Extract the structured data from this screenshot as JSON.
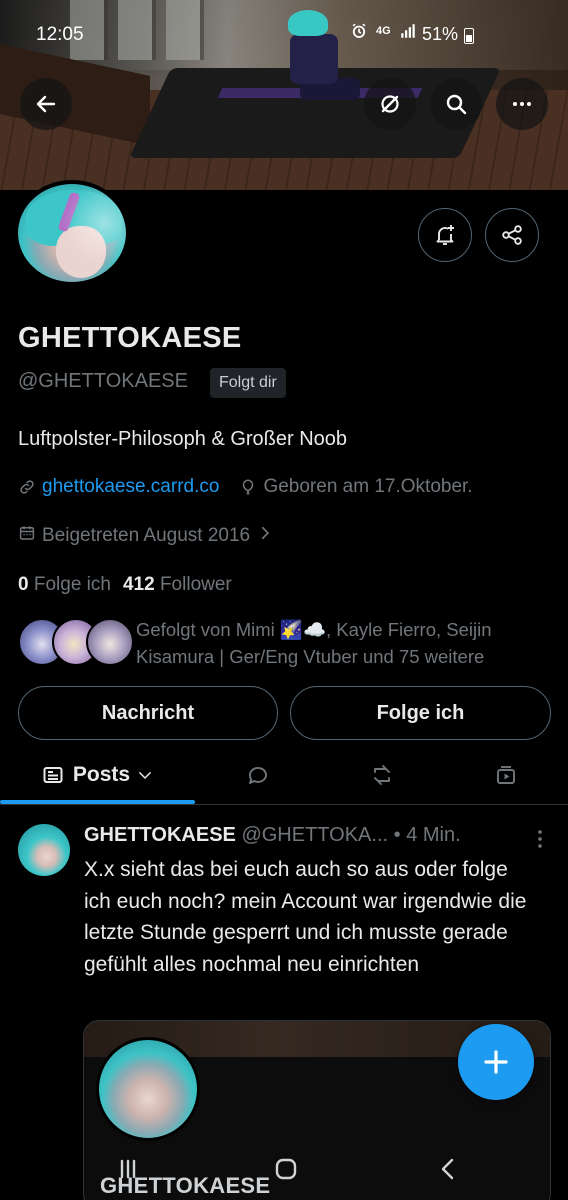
{
  "status_bar": {
    "time": "12:05",
    "network": "4G",
    "battery_percent": "51%"
  },
  "header": {
    "back_icon": "arrow-left-icon",
    "grok_icon": "slash-circle-icon",
    "search_icon": "search-icon",
    "more_icon": "more-horizontal-icon"
  },
  "profile": {
    "display_name": "GHETTOKAESE",
    "handle": "@GHETTOKAESE",
    "follows_you_badge": "Folgt dir",
    "bio": "Luftpolster-Philosoph & Großer Noob",
    "website": "ghettokaese.carrd.co",
    "birthday": "Geboren am 17.Oktober.",
    "joined": "Beigetreten August 2016",
    "following_count": "0",
    "following_label": "Folge ich",
    "followers_count": "412",
    "followers_label": "Follower",
    "followed_by_text": "Gefolgt von Mimi 🌠☁️, Kayle Fierro, Seijin Kisamura | Ger/Eng Vtuber und 75 weitere",
    "notify_icon": "bell-plus-icon",
    "share_icon": "share-icon"
  },
  "actions": {
    "message_label": "Nachricht",
    "follow_label": "Folge ich"
  },
  "tabs": {
    "active_label": "Posts",
    "icons": [
      "posts-icon",
      "reply-bubble-icon",
      "repost-icon",
      "media-play-icon"
    ]
  },
  "post": {
    "author_name": "GHETTOKAESE",
    "author_handle": "@GHETTOKA...",
    "separator": "•",
    "time_ago": "4 Min.",
    "text": "X.x sieht das bei euch auch so aus oder folge ich euch noch? mein Account war irgendwie die letzte Stunde gesperrt und ich musste gerade gefühlt alles nochmal neu einrichten",
    "card_name": "GHETTOKAESE"
  },
  "fab": {
    "icon": "plus-icon"
  },
  "system_nav": {
    "recents_icon": "recents-icon",
    "home_icon": "home-icon",
    "back_icon": "back-chevron-icon"
  },
  "colors": {
    "accent": "#1d9bf0",
    "background": "#000000",
    "text_primary": "#e7e9ea",
    "text_secondary": "#71767b"
  }
}
